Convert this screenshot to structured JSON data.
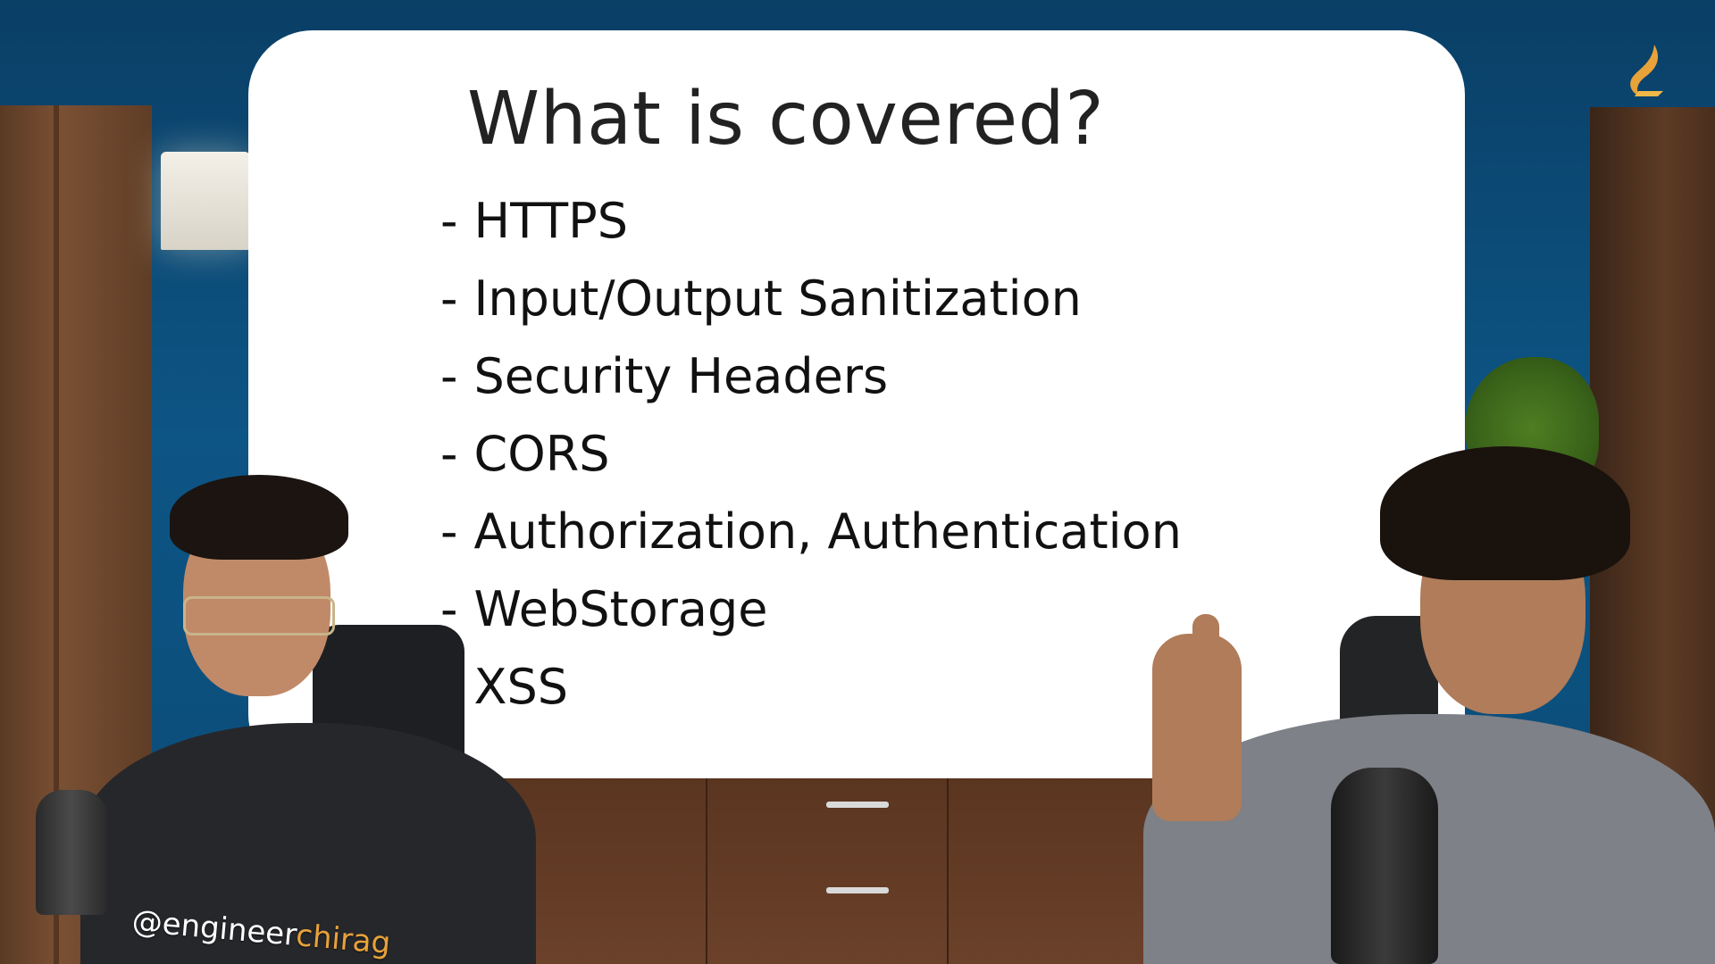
{
  "slide": {
    "title": "What is covered?",
    "topics": [
      "HTTPS",
      "Input/Output Sanitization",
      "Security Headers",
      "CORS",
      "Authorization, Authentication",
      "WebStorage",
      "XSS"
    ],
    "bullet": "-"
  },
  "overlay": {
    "handle_prefix": "@engineer",
    "handle_suffix": "chirag"
  },
  "colors": {
    "background": "#0d5585",
    "slide": "#ffffff",
    "title_text": "#222222",
    "body_text": "#111111",
    "logo_accent": "#e8a23a"
  },
  "icons": {
    "logo": "flame-logo-icon"
  }
}
